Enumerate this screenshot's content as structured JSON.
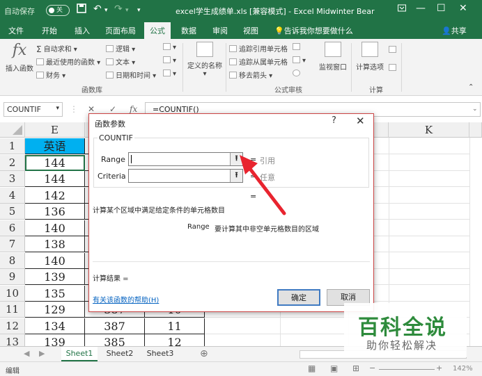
{
  "titlebar": {
    "autosave_label": "自动保存",
    "autosave_state": "关",
    "doc_title": "excel学生成绩单.xls [兼容模式] - Excel   Midwinter Bear",
    "accent": "#217346"
  },
  "tabs": [
    "文件",
    "开始",
    "插入",
    "页面布局",
    "公式",
    "数据",
    "审阅",
    "视图"
  ],
  "active_tab": "公式",
  "tell_me": "告诉我你想要做什么",
  "share": "共享",
  "ribbon": {
    "insert_function": "插入函数",
    "fx_glyph": "fx",
    "autosum": "自动求和",
    "recent": "最近使用的函数",
    "financial": "财务",
    "logical": "逻辑",
    "text": "文本",
    "datetime": "日期和时间",
    "defined_names": "定义的名称",
    "group_library": "函数库",
    "trace_precedents": "追踪引用单元格",
    "trace_dependents": "追踪从属单元格",
    "remove_arrows": "移去箭头",
    "watch_window": "监视窗口",
    "group_audit": "公式审核",
    "calc_options": "计算选项",
    "group_calc": "计算"
  },
  "formula_bar": {
    "name_box": "COUNTIF",
    "formula": "=COUNTIF()",
    "cancel": "✕",
    "enter": "✓",
    "fx": "fx"
  },
  "grid": {
    "col_e": "E",
    "col_k": "K",
    "rows": [
      {
        "n": "1",
        "e": "英语",
        "f": "",
        "g": ""
      },
      {
        "n": "2",
        "e": "144",
        "f": "",
        "g": ""
      },
      {
        "n": "3",
        "e": "144",
        "f": "",
        "g": ""
      },
      {
        "n": "4",
        "e": "142",
        "f": "",
        "g": ""
      },
      {
        "n": "5",
        "e": "136",
        "f": "",
        "g": ""
      },
      {
        "n": "6",
        "e": "140",
        "f": "",
        "g": ""
      },
      {
        "n": "7",
        "e": "138",
        "f": "",
        "g": ""
      },
      {
        "n": "8",
        "e": "140",
        "f": "",
        "g": ""
      },
      {
        "n": "9",
        "e": "139",
        "f": "",
        "g": ""
      },
      {
        "n": "10",
        "e": "135",
        "f": "",
        "g": ""
      },
      {
        "n": "11",
        "e": "129",
        "f": "387",
        "g": "10"
      },
      {
        "n": "12",
        "e": "134",
        "f": "387",
        "g": "11"
      },
      {
        "n": "13",
        "e": "139",
        "f": "385",
        "g": "12"
      }
    ]
  },
  "dialog": {
    "title": "函数参数",
    "help": "?",
    "close": "✕",
    "func_name": "COUNTIF",
    "arg1_label": "Range",
    "arg1_hint": "引用",
    "arg2_label": "Criteria",
    "arg2_hint": "任意",
    "eq": "=",
    "description": "计算某个区域中满足给定条件的单元格数目",
    "arg_desc_name": "Range",
    "arg_desc_text": "要计算其中非空单元格数目的区域",
    "result_label": "计算结果 =",
    "help_link": "有关该函数的帮助(H)",
    "ok": "确定",
    "cancel": "取消",
    "collapse_glyph": "⭱"
  },
  "sheets": [
    "Sheet1",
    "Sheet2",
    "Sheet3"
  ],
  "active_sheet": "Sheet1",
  "status": {
    "mode": "编辑",
    "zoom": "142%"
  },
  "watermark": {
    "title": "百科全说",
    "subtitle": "助你轻松解决"
  }
}
